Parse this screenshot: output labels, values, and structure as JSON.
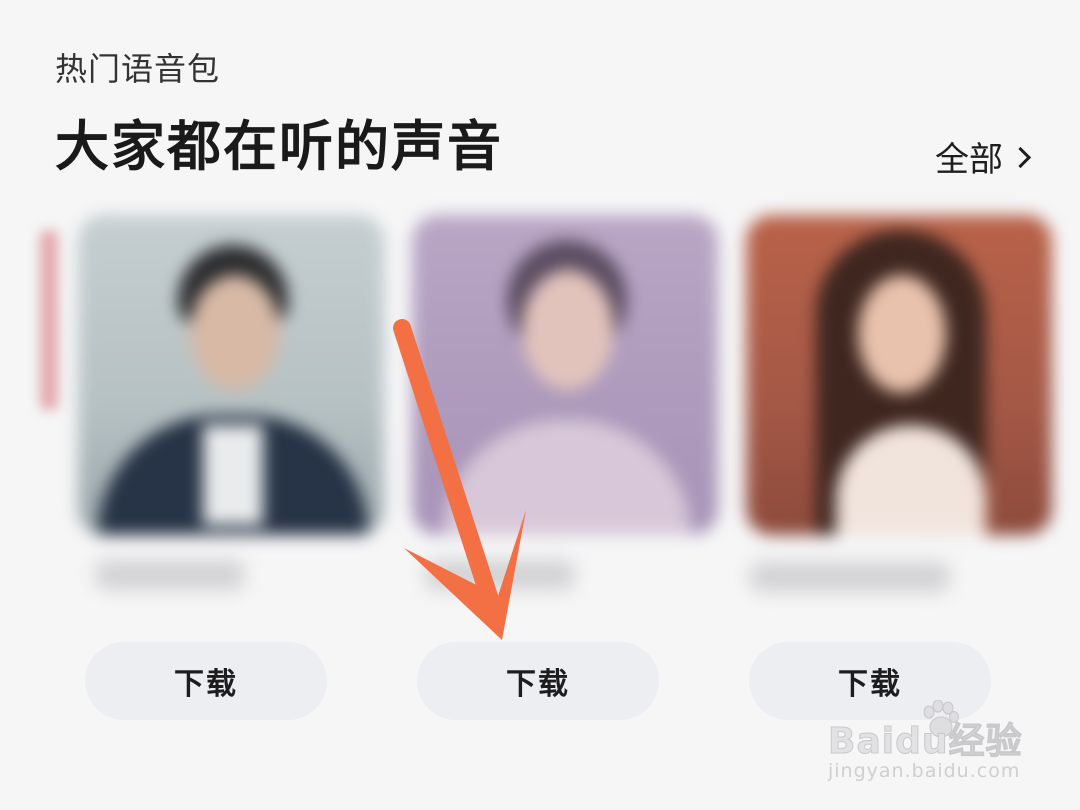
{
  "section": {
    "label": "热门语音包",
    "title": "大家都在听的声音",
    "view_all_label": "全部"
  },
  "voice_packs": [
    {
      "download_label": "下载"
    },
    {
      "download_label": "下载"
    },
    {
      "download_label": "下载"
    }
  ],
  "annotation": {
    "arrow_color": "#f27043"
  },
  "watermark": {
    "brand": "Baidu经验",
    "url": "jingyan.baidu.com"
  },
  "icons": {
    "view_all": "chevron-right-icon",
    "watermark_logo": "paw-icon"
  }
}
